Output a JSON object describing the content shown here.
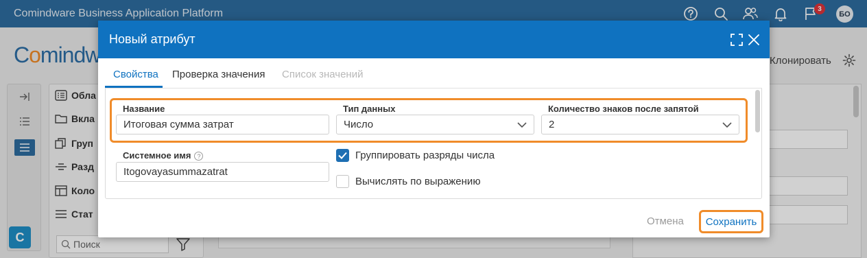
{
  "app": {
    "title": "Comindware Business Application Platform",
    "notification_count": "3",
    "user_initials": "БО",
    "logo_text_a": "C",
    "logo_text_b": "o",
    "logo_text_c": "mindw"
  },
  "toolbar": {
    "clone_label": "Клонировать"
  },
  "nav": {
    "items": [
      {
        "label": "Обла",
        "icon": "list-icon"
      },
      {
        "label": "Вкла",
        "icon": "folder-icon"
      },
      {
        "label": "Груп",
        "icon": "copy-icon"
      },
      {
        "label": "Разд",
        "icon": "divider-icon"
      },
      {
        "label": "Коло",
        "icon": "columns-icon"
      },
      {
        "label": "Стат",
        "icon": "lines-icon"
      }
    ],
    "search_placeholder": "Поиск",
    "rail_logo": "C"
  },
  "dialog": {
    "title": "Новый атрибут",
    "tabs": [
      {
        "label": "Свойства",
        "state": "active"
      },
      {
        "label": "Проверка значения",
        "state": "normal"
      },
      {
        "label": "Список значений",
        "state": "disabled"
      }
    ],
    "fields": {
      "name_label": "Название",
      "name_value": "Итоговая сумма затрат",
      "type_label": "Тип данных",
      "type_value": "Число",
      "decimals_label": "Количество знаков после запятой",
      "decimals_value": "2",
      "system_name_label": "Системное имя",
      "system_name_value": "Itogovayasummazatrat"
    },
    "checkboxes": [
      {
        "label": "Группировать разряды числа",
        "checked": true
      },
      {
        "label": "Вычислять по выражению",
        "checked": false
      }
    ],
    "cancel_label": "Отмена",
    "save_label": "Сохранить"
  },
  "colors": {
    "header": "#2e6da0",
    "dialog_header": "#0f72c0",
    "highlight": "#f08c2a",
    "checkbox": "#1e6fb3"
  }
}
